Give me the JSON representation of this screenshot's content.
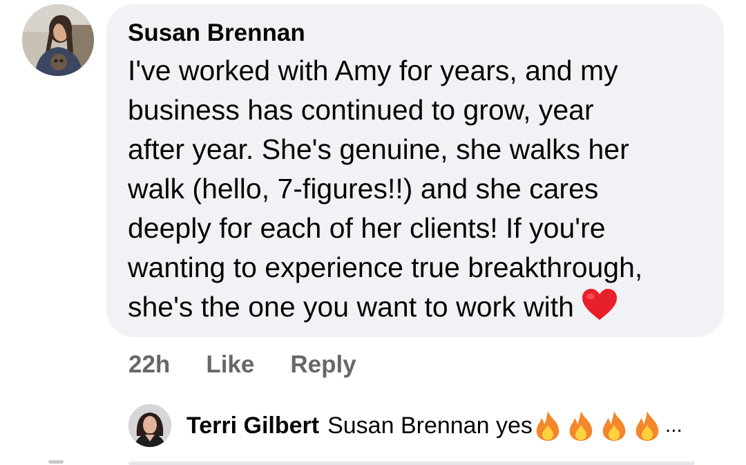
{
  "comment": {
    "author": "Susan Brennan",
    "lines": [
      "I've worked with Amy for years, and my",
      "business has continued to grow, year",
      "after year. She's genuine, she walks her",
      "walk (hello, 7-figures!!) and she cares",
      "deeply for each of her clients! If you're",
      "wanting to experience true breakthrough,",
      "she's the one you want to work with"
    ],
    "emoji_icon": "red-heart-icon",
    "timestamp": "22h",
    "like_label": "Like",
    "reply_label": "Reply"
  },
  "reply": {
    "author": "Terri Gilbert",
    "text": "Susan Brennan yes",
    "emoji_icon": "fire-icon",
    "emoji_count": 4,
    "ellipsis": "..."
  },
  "colors": {
    "bubble": "#f0f2f5",
    "text": "#050505",
    "muted": "#65676b",
    "heart": "#e8202a",
    "flame_outer": "#f4862b",
    "flame_inner": "#ffd23f"
  }
}
